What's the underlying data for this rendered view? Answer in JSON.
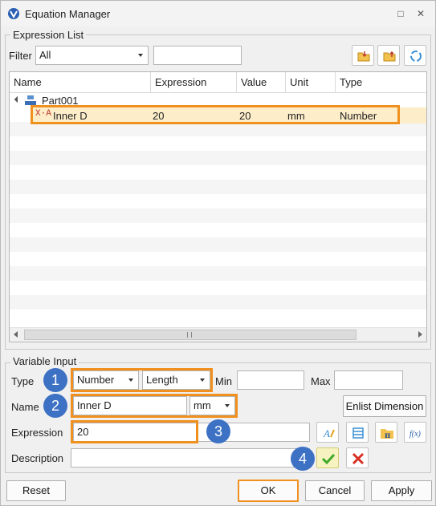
{
  "window": {
    "title": "Equation Manager"
  },
  "expression_list": {
    "label": "Expression List",
    "filter_label": "Filter",
    "filter_value": "All",
    "filter_text": "",
    "columns": [
      "Name",
      "Expression",
      "Value",
      "Unit",
      "Type"
    ],
    "part_name": "Part001",
    "rows": [
      {
        "name": "Inner D",
        "expression": "20",
        "value": "20",
        "unit": "mm",
        "type": "Number",
        "selected": true
      }
    ]
  },
  "variable_input": {
    "label": "Variable Input",
    "type_label": "Type",
    "type_value": "Number",
    "subtype_value": "Length",
    "min_label": "Min",
    "min_value": "",
    "max_label": "Max",
    "max_value": "",
    "name_label": "Name",
    "name_value": "Inner D",
    "unit_value": "mm",
    "enlist_label": "Enlist Dimension",
    "expression_label": "Expression",
    "expression_value": "20",
    "description_label": "Description",
    "description_value": ""
  },
  "callouts": [
    "1",
    "2",
    "3",
    "4"
  ],
  "footer": {
    "reset": "Reset",
    "ok": "OK",
    "cancel": "Cancel",
    "apply": "Apply"
  },
  "colors": {
    "highlight": "#f0901e",
    "callout": "#3d71c4",
    "selected_row": "#fdedc9"
  }
}
